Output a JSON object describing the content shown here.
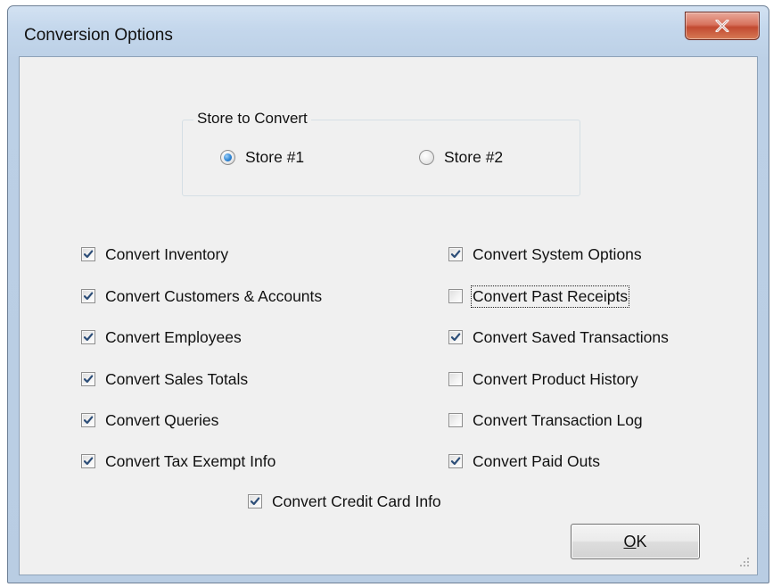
{
  "window": {
    "title": "Conversion Options",
    "close_glyph": "✕"
  },
  "store_group": {
    "legend": "Store to Convert",
    "options": [
      {
        "label": "Store #1",
        "selected": true
      },
      {
        "label": "Store #2",
        "selected": false
      }
    ]
  },
  "left_options": [
    {
      "label": "Convert Inventory",
      "checked": true
    },
    {
      "label": "Convert Customers & Accounts",
      "checked": true
    },
    {
      "label": "Convert Employees",
      "checked": true
    },
    {
      "label": "Convert Sales Totals",
      "checked": true
    },
    {
      "label": "Convert Queries",
      "checked": true
    },
    {
      "label": "Convert Tax Exempt Info",
      "checked": true
    }
  ],
  "right_options": [
    {
      "label": "Convert System Options",
      "checked": true
    },
    {
      "label": "Convert Past Receipts",
      "checked": false,
      "focused": true
    },
    {
      "label": "Convert Saved Transactions",
      "checked": true
    },
    {
      "label": "Convert Product History",
      "checked": false
    },
    {
      "label": "Convert Transaction Log",
      "checked": false
    },
    {
      "label": "Convert Paid Outs",
      "checked": true
    }
  ],
  "bottom_option": {
    "label": "Convert Credit Card Info",
    "checked": true
  },
  "ok_button": {
    "mnemonic": "O",
    "rest": "K"
  },
  "colors": {
    "check_mark": "#2d4e78",
    "close_button": "#c7503a",
    "radio_selected": "#2f86d4"
  }
}
